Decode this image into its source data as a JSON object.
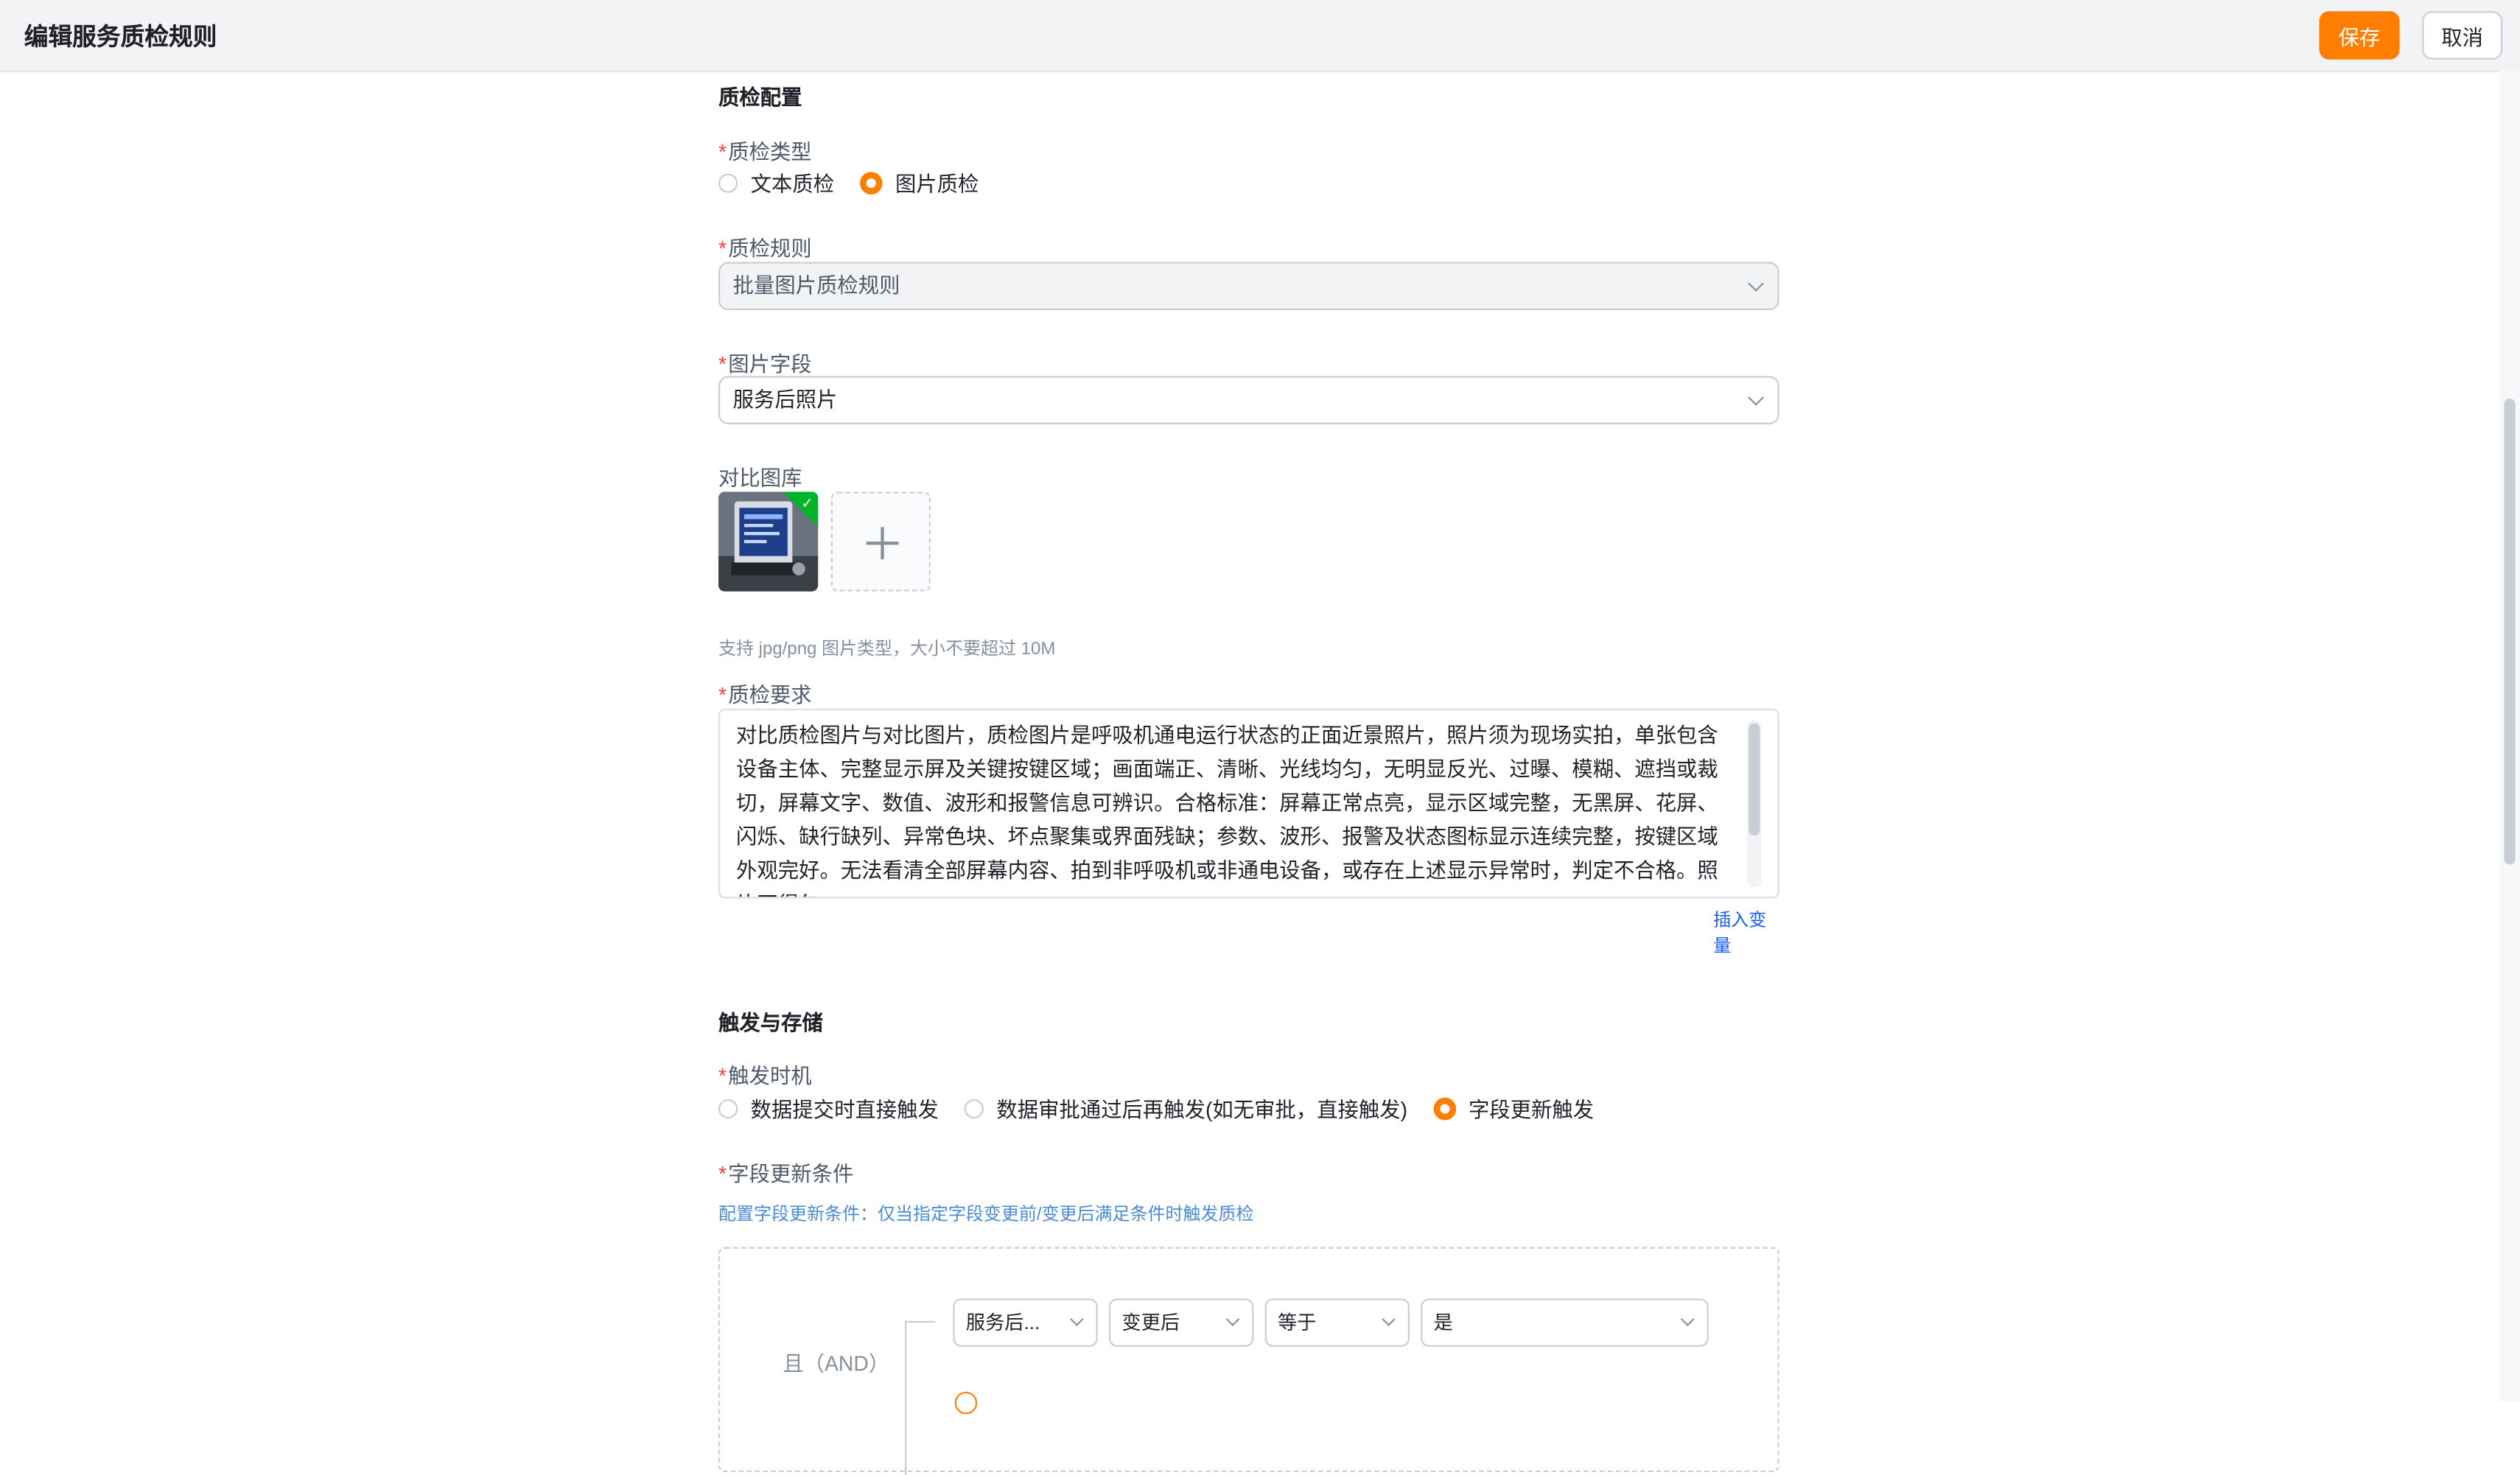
{
  "header": {
    "title": "编辑服务质检规则",
    "save_label": "保存",
    "cancel_label": "取消"
  },
  "section_quality": {
    "title": "质检配置"
  },
  "inspection_type": {
    "label": "质检类型",
    "options": [
      {
        "label": "文本质检",
        "selected": false
      },
      {
        "label": "图片质检",
        "selected": true
      }
    ]
  },
  "inspection_rule": {
    "label": "质检规则",
    "value": "批量图片质检规则",
    "disabled": true
  },
  "image_field": {
    "label": "图片字段",
    "value": "服务后照片"
  },
  "gallery": {
    "label": "对比图库",
    "hint": "支持 jpg/png 图片类型，大小不要超过 10M",
    "thumb_icon": "check-icon",
    "add_icon": "plus-icon"
  },
  "requirement": {
    "label": "质检要求",
    "text": "对比质检图片与对比图片，质检图片是呼吸机通电运行状态的正面近景照片，照片须为现场实拍，单张包含设备主体、完整显示屏及关键按键区域；画面端正、清晰、光线均匀，无明显反光、过曝、模糊、遮挡或裁切，屏幕文字、数值、波形和报警信息可辨识。合格标准：屏幕正常点亮，显示区域完整，无黑屏、花屏、闪烁、缺行缺列、异常色块、坏点聚集或界面残缺；参数、波形、报警及状态图标显示连续完整，按键区域外观完好。无法看清全部屏幕内容、拍到非呼吸机或非通电设备，或存在上述显示异常时，判定不合格。照片不得包",
    "insert_variable": "插入变量"
  },
  "section_trigger": {
    "title": "触发与存储"
  },
  "trigger_timing": {
    "label": "触发时机",
    "options": [
      {
        "label": "数据提交时直接触发",
        "selected": false
      },
      {
        "label": "数据审批通过后再触发(如无审批，直接触发)",
        "selected": false
      },
      {
        "label": "字段更新触发",
        "selected": true
      }
    ]
  },
  "field_update": {
    "label": "字段更新条件",
    "hint": "配置字段更新条件：仅当指定字段变更前/变更后满足条件时触发质检",
    "logic": "且（AND）",
    "condition": {
      "field": "服务后...",
      "stage": "变更后",
      "operator": "等于",
      "value": "是"
    }
  },
  "colors": {
    "accent": "#ff7d00",
    "required": "#f53f3f",
    "link": "#165dff"
  }
}
